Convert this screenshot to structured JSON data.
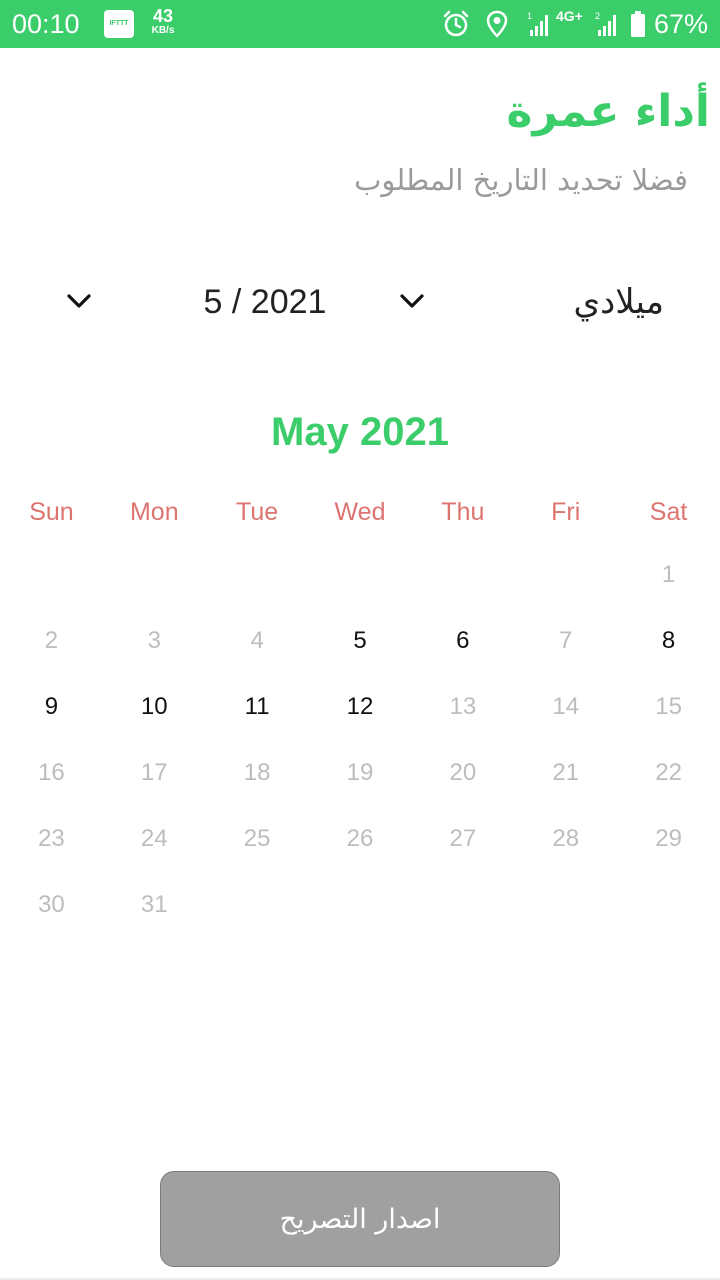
{
  "status_bar": {
    "time": "00:10",
    "ifttt_label": "IFTTT",
    "speed_value": "43",
    "speed_unit": "KB/s",
    "network_type": "4G+",
    "battery_percent": "67%"
  },
  "header": {
    "title": "أداء عمرة",
    "subtitle": "فضلا تحديد التاريخ المطلوب"
  },
  "selectors": {
    "month_year": "5 / 2021",
    "calendar_type": "ميلادي"
  },
  "calendar": {
    "title": "May 2021",
    "weekdays": [
      "Sun",
      "Mon",
      "Tue",
      "Wed",
      "Thu",
      "Fri",
      "Sat"
    ],
    "first_weekday_index": 6,
    "days": [
      {
        "day": "1",
        "enabled": false
      },
      {
        "day": "2",
        "enabled": false
      },
      {
        "day": "3",
        "enabled": false
      },
      {
        "day": "4",
        "enabled": false
      },
      {
        "day": "5",
        "enabled": true
      },
      {
        "day": "6",
        "enabled": true
      },
      {
        "day": "7",
        "enabled": false
      },
      {
        "day": "8",
        "enabled": true
      },
      {
        "day": "9",
        "enabled": true
      },
      {
        "day": "10",
        "enabled": true
      },
      {
        "day": "11",
        "enabled": true
      },
      {
        "day": "12",
        "enabled": true
      },
      {
        "day": "13",
        "enabled": false
      },
      {
        "day": "14",
        "enabled": false
      },
      {
        "day": "15",
        "enabled": false
      },
      {
        "day": "16",
        "enabled": false
      },
      {
        "day": "17",
        "enabled": false
      },
      {
        "day": "18",
        "enabled": false
      },
      {
        "day": "19",
        "enabled": false
      },
      {
        "day": "20",
        "enabled": false
      },
      {
        "day": "21",
        "enabled": false
      },
      {
        "day": "22",
        "enabled": false
      },
      {
        "day": "23",
        "enabled": false
      },
      {
        "day": "24",
        "enabled": false
      },
      {
        "day": "25",
        "enabled": false
      },
      {
        "day": "26",
        "enabled": false
      },
      {
        "day": "27",
        "enabled": false
      },
      {
        "day": "28",
        "enabled": false
      },
      {
        "day": "29",
        "enabled": false
      },
      {
        "day": "30",
        "enabled": false
      },
      {
        "day": "31",
        "enabled": false
      }
    ]
  },
  "action_button": {
    "label": "اصدار التصريح"
  },
  "colors": {
    "accent": "#3ccd6b",
    "weekday": "#dd7470",
    "day_enabled": "#111111",
    "day_disabled": "#bdbdbd",
    "button_disabled": "#a0a0a0"
  },
  "icons": {
    "status": [
      "alarm-icon",
      "location-icon",
      "signal-icon",
      "battery-icon"
    ],
    "dropdown": "chevron-down-icon"
  }
}
